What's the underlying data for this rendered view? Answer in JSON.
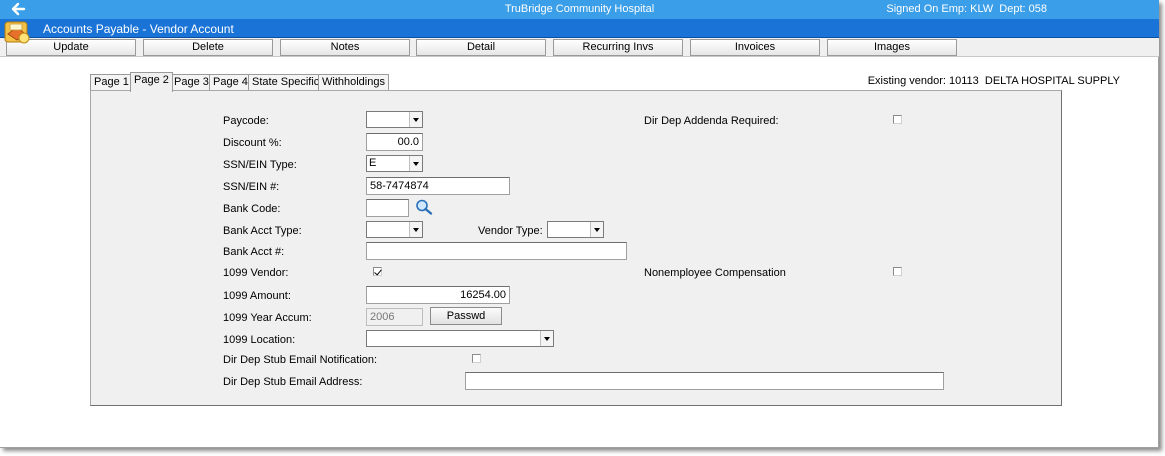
{
  "topbar": {
    "back_icon": "back-arrow-icon",
    "center_title": "TruBridge Community Hospital",
    "signon": "Signed On Emp: KLW  Dept: 058"
  },
  "titlebar": {
    "app_icon": "accounts-payable-icon",
    "title": "Accounts Payable - Vendor Account"
  },
  "toolbar": {
    "update": "Update",
    "delete": "Delete",
    "notes": "Notes",
    "detail": "Detail",
    "recurring": "Recurring Invs",
    "invoices": "Invoices",
    "images": "Images"
  },
  "tabs": {
    "page1": "Page 1",
    "page2": "Page 2",
    "page3": "Page 3",
    "page4": "Page 4",
    "state": "State Specific",
    "withholdings": "Withholdings",
    "active": "Page 2"
  },
  "vendor_info": "Existing vendor: 10113  DELTA HOSPITAL SUPPLY",
  "form": {
    "paycode_label": "Paycode:",
    "paycode_value": "",
    "discount_label": "Discount %:",
    "discount_value": "00.0",
    "ssn_type_label": "SSN/EIN Type:",
    "ssn_type_value": "E",
    "ssn_label": "SSN/EIN #:",
    "ssn_value": "58-7474874",
    "bank_code_label": "Bank Code:",
    "bank_code_value": "",
    "search_icon": "magnifier-search-icon",
    "bank_acct_type_label": "Bank Acct Type:",
    "bank_acct_type_value": "",
    "vendor_type_label": "Vendor Type:",
    "vendor_type_value": "",
    "bank_acct_label": "Bank Acct #:",
    "bank_acct_value": "",
    "vendor_1099_label": "1099 Vendor:",
    "vendor_1099_checked": true,
    "amount_1099_label": "1099 Amount:",
    "amount_1099_value": "16254.00",
    "year_accum_label": "1099 Year Accum:",
    "year_accum_value": "2006",
    "passwd_button": "Passwd",
    "location_1099_label": "1099 Location:",
    "location_1099_value": "",
    "stub_email_notif_label": "Dir Dep Stub Email Notification:",
    "stub_email_notif_checked": false,
    "stub_email_addr_label": "Dir Dep Stub Email Address:",
    "stub_email_addr_value": "",
    "addenda_label": "Dir Dep Addenda Required:",
    "addenda_checked": false,
    "nonemployee_label": "Nonemployee Compensation",
    "nonemployee_checked": false
  }
}
